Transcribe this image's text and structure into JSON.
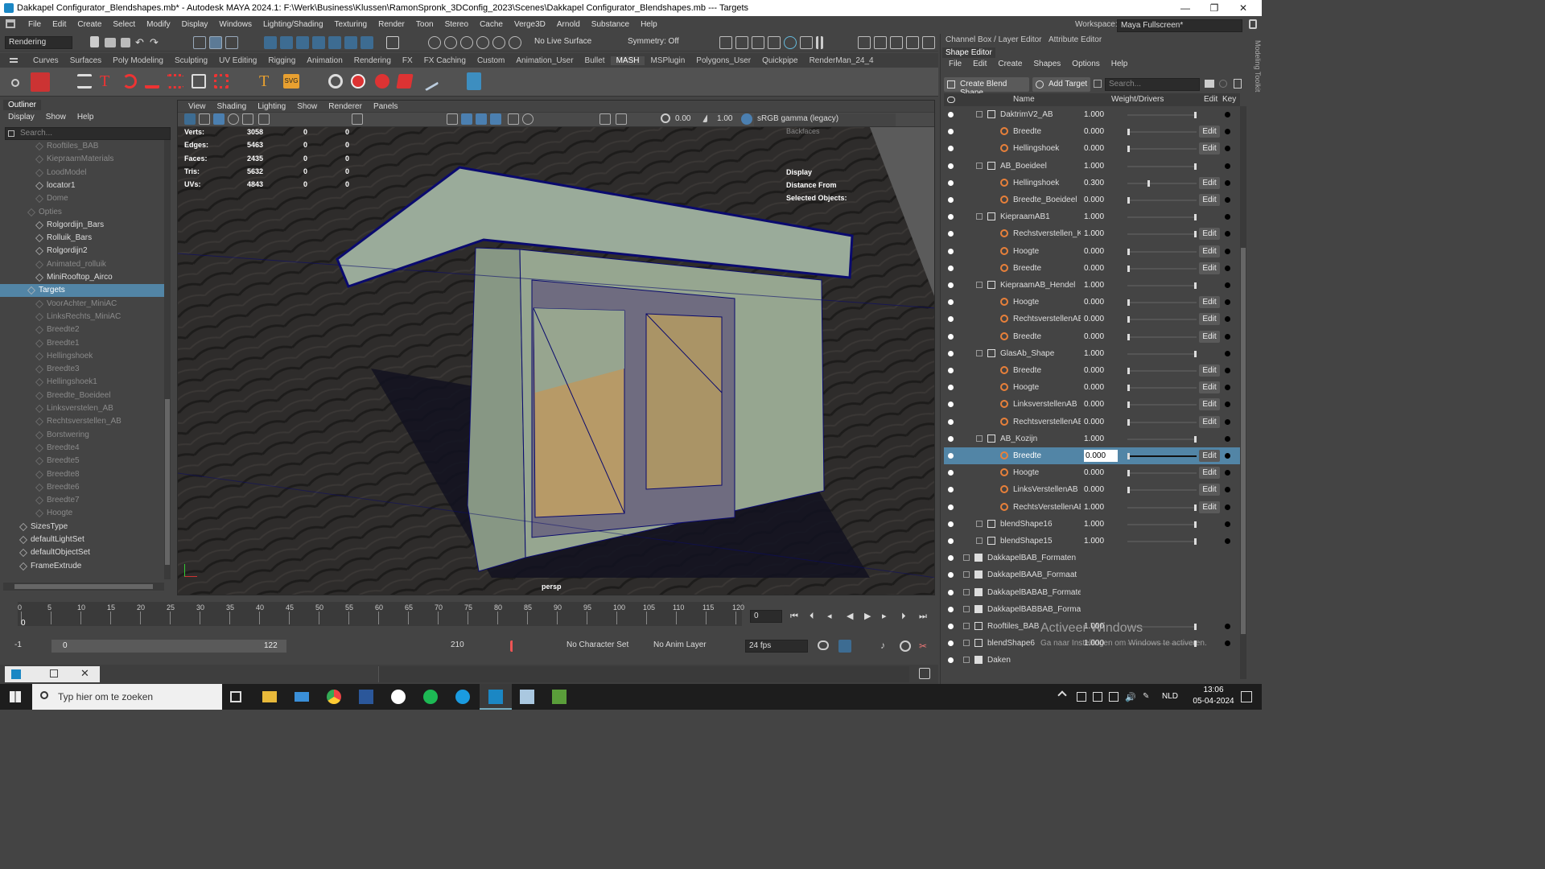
{
  "titlebar": {
    "title": "Dakkapel Configurator_Blendshapes.mb* - Autodesk MAYA 2024.1: F:\\Werk\\Business\\Klussen\\RamonSpronk_3DConfig_2023\\Scenes\\Dakkapel Configurator_Blendshapes.mb    ---    Targets",
    "minimize": "—",
    "maximize": "❐",
    "close": "✕"
  },
  "menubar": {
    "items": [
      "File",
      "Edit",
      "Create",
      "Select",
      "Modify",
      "Display",
      "Windows",
      "Lighting/Shading",
      "Texturing",
      "Render",
      "Toon",
      "Stereo",
      "Cache",
      "Verge3D",
      "Arnold",
      "Substance",
      "Help"
    ]
  },
  "statusline": {
    "menuset": "Rendering",
    "live_surface": "No Live Surface",
    "symmetry": "Symmetry: Off"
  },
  "workspace": {
    "label": "Workspace:",
    "value": "Maya Fullscreen*"
  },
  "shelf": {
    "tabs": [
      "Curves",
      "Surfaces",
      "Poly Modeling",
      "Sculpting",
      "UV Editing",
      "Rigging",
      "Animation",
      "Rendering",
      "FX",
      "FX Caching",
      "Custom",
      "Animation_User",
      "Bullet",
      "MASH",
      "MSPlugin",
      "Polygons_User",
      "Quickpipe",
      "RenderMan_24_4"
    ],
    "active_tab": "MASH"
  },
  "outliner": {
    "title": "Outliner",
    "menu": [
      "Display",
      "Show",
      "Help"
    ],
    "search_placeholder": "Search...",
    "rows": [
      {
        "label": "Rooftiles_BAB",
        "dim": true
      },
      {
        "label": "KiepraamMaterials",
        "dim": true
      },
      {
        "label": "LoodModel",
        "dim": true
      },
      {
        "label": "locator1",
        "dim": false
      },
      {
        "label": "Dome",
        "dim": true
      },
      {
        "label": "Opties",
        "dim": true
      },
      {
        "label": "Rolgordijn_Bars",
        "dim": false
      },
      {
        "label": "Rolluik_Bars",
        "dim": false
      },
      {
        "label": "Rolgordijn2",
        "dim": false
      },
      {
        "label": "Animated_rolluik",
        "dim": true
      },
      {
        "label": "MiniRooftop_Airco",
        "dim": false
      },
      {
        "label": "Targets",
        "dim": false,
        "selected": true
      },
      {
        "label": "VoorAchter_MiniAC",
        "dim": true
      },
      {
        "label": "LinksRechts_MiniAC",
        "dim": true
      },
      {
        "label": "Breedte2",
        "dim": true
      },
      {
        "label": "Breedte1",
        "dim": true
      },
      {
        "label": "Hellingshoek",
        "dim": true
      },
      {
        "label": "Breedte3",
        "dim": true
      },
      {
        "label": "Hellingshoek1",
        "dim": true
      },
      {
        "label": "Breedte_Boeideel",
        "dim": true
      },
      {
        "label": "Linksverstelen_AB",
        "dim": true
      },
      {
        "label": "Rechtsverstellen_AB",
        "dim": true
      },
      {
        "label": "Borstwering",
        "dim": true
      },
      {
        "label": "Breedte4",
        "dim": true
      },
      {
        "label": "Breedte5",
        "dim": true
      },
      {
        "label": "Breedte8",
        "dim": true
      },
      {
        "label": "Breedte6",
        "dim": true
      },
      {
        "label": "Breedte7",
        "dim": true
      },
      {
        "label": "Hoogte",
        "dim": true
      },
      {
        "label": "SizesType",
        "dim": false
      },
      {
        "label": "defaultLightSet",
        "dim": false
      },
      {
        "label": "defaultObjectSet",
        "dim": false
      },
      {
        "label": "FrameExtrude",
        "dim": false
      }
    ]
  },
  "viewport": {
    "menu": [
      "View",
      "Shading",
      "Lighting",
      "Show",
      "Renderer",
      "Panels"
    ],
    "exposure": "0.00",
    "gamma": "1.00",
    "colorspace": "sRGB gamma (legacy)",
    "camera": "persp",
    "hud": [
      {
        "label": "Verts:",
        "a": "3058",
        "b": "0",
        "c": "0"
      },
      {
        "label": "Edges:",
        "a": "5463",
        "b": "0",
        "c": "0"
      },
      {
        "label": "Faces:",
        "a": "2435",
        "b": "0",
        "c": "0"
      },
      {
        "label": "Tris:",
        "a": "5632",
        "b": "0",
        "c": "0"
      },
      {
        "label": "UVs:",
        "a": "4843",
        "b": "0",
        "c": "0"
      }
    ],
    "hud_right": [
      "Display",
      "Distance From",
      "Selected Objects:"
    ],
    "backfaces": "Backfaces"
  },
  "timeline": {
    "ticks": [
      "0",
      "5",
      "10",
      "15",
      "20",
      "25",
      "30",
      "35",
      "40",
      "45",
      "50",
      "55",
      "60",
      "65",
      "70",
      "75",
      "80",
      "85",
      "90",
      "95",
      "100",
      "105",
      "110",
      "115",
      "120"
    ],
    "current_frame": "0",
    "current_field": "0"
  },
  "range": {
    "start": "-1",
    "inner_start": "0",
    "inner_end": "122",
    "end": "210",
    "character_set": "No Character Set",
    "anim_layer": "No Anim Layer",
    "fps": "24 fps"
  },
  "channel_tabs": [
    "Channel Box / Layer Editor",
    "Attribute Editor"
  ],
  "shape_editor": {
    "title": "Shape Editor",
    "menu": [
      "File",
      "Edit",
      "Create",
      "Shapes",
      "Options",
      "Help"
    ],
    "create_blend": "Create Blend Shape",
    "add_target": "Add Target",
    "search_placeholder": "Search...",
    "columns": {
      "name": "Name",
      "weight": "Weight/Drivers",
      "edit": "Edit",
      "key": "Key"
    },
    "edit_label": "Edit",
    "rows": [
      {
        "name": "DaktrimV2_AB",
        "weight": "1.000",
        "level": 1,
        "type": "blend",
        "pos": 1.0
      },
      {
        "name": "Breedte",
        "weight": "0.000",
        "level": 2,
        "type": "target",
        "pos": 0.0
      },
      {
        "name": "Hellingshoek",
        "weight": "0.000",
        "level": 2,
        "type": "target",
        "pos": 0.0
      },
      {
        "name": "AB_Boeideel",
        "weight": "1.000",
        "level": 1,
        "type": "blend",
        "pos": 1.0
      },
      {
        "name": "Hellingshoek",
        "weight": "0.300",
        "level": 2,
        "type": "target",
        "pos": 0.3
      },
      {
        "name": "Breedte_Boeideel",
        "weight": "0.000",
        "level": 2,
        "type": "target",
        "pos": 0.0
      },
      {
        "name": "KiepraamAB1",
        "weight": "1.000",
        "level": 1,
        "type": "blend",
        "pos": 1.0
      },
      {
        "name": "Rechstverstellen_Kie",
        "weight": "1.000",
        "level": 2,
        "type": "target",
        "pos": 1.0
      },
      {
        "name": "Hoogte",
        "weight": "0.000",
        "level": 2,
        "type": "target",
        "pos": 0.0
      },
      {
        "name": "Breedte",
        "weight": "0.000",
        "level": 2,
        "type": "target",
        "pos": 0.0
      },
      {
        "name": "KiepraamAB_Hendel",
        "weight": "1.000",
        "level": 1,
        "type": "blend",
        "pos": 1.0
      },
      {
        "name": "Hoogte",
        "weight": "0.000",
        "level": 2,
        "type": "target",
        "pos": 0.0
      },
      {
        "name": "RechtsverstellenAB_H",
        "weight": "0.000",
        "level": 2,
        "type": "target",
        "pos": 0.0
      },
      {
        "name": "Breedte",
        "weight": "0.000",
        "level": 2,
        "type": "target",
        "pos": 0.0
      },
      {
        "name": "GlasAb_Shape",
        "weight": "1.000",
        "level": 1,
        "type": "blend",
        "pos": 1.0
      },
      {
        "name": "Breedte",
        "weight": "0.000",
        "level": 2,
        "type": "target",
        "pos": 0.0
      },
      {
        "name": "Hoogte",
        "weight": "0.000",
        "level": 2,
        "type": "target",
        "pos": 0.0
      },
      {
        "name": "LinksverstellenAB",
        "weight": "0.000",
        "level": 2,
        "type": "target",
        "pos": 0.0
      },
      {
        "name": "RechtsverstellenAB",
        "weight": "0.000",
        "level": 2,
        "type": "target",
        "pos": 0.0
      },
      {
        "name": "AB_Kozijn",
        "weight": "1.000",
        "level": 1,
        "type": "blend",
        "pos": 1.0
      },
      {
        "name": "Breedte",
        "weight": "0.000",
        "level": 2,
        "type": "target",
        "pos": 0.0,
        "selected": true
      },
      {
        "name": "Hoogte",
        "weight": "0.000",
        "level": 2,
        "type": "target",
        "pos": 0.0
      },
      {
        "name": "LinksVerstellenAB",
        "weight": "0.000",
        "level": 2,
        "type": "target",
        "pos": 0.0
      },
      {
        "name": "RechtsVerstellenAB",
        "weight": "1.000",
        "level": 2,
        "type": "target",
        "pos": 1.0
      },
      {
        "name": "blendShape16",
        "weight": "1.000",
        "level": 1,
        "type": "blend",
        "pos": 1.0,
        "collapsed": true
      },
      {
        "name": "blendShape15",
        "weight": "1.000",
        "level": 1,
        "type": "blend",
        "pos": 1.0,
        "collapsed": true
      },
      {
        "name": "DakkapelBAB_Formaten",
        "weight": "",
        "level": 0,
        "type": "folder"
      },
      {
        "name": "DakkapelBAAB_Formaat",
        "weight": "",
        "level": 0,
        "type": "folder"
      },
      {
        "name": "DakkapelBABAB_Formaten",
        "weight": "",
        "level": 0,
        "type": "folder"
      },
      {
        "name": "DakkapelBABBAB_Formaten",
        "weight": "",
        "level": 0,
        "type": "folder"
      },
      {
        "name": "Rooftiles_BAB",
        "weight": "1.000",
        "level": 0,
        "type": "blend",
        "pos": 1.0,
        "collapsed": true
      },
      {
        "name": "blendShape6",
        "weight": "1.000",
        "level": 0,
        "type": "blend",
        "pos": 1.0
      },
      {
        "name": "Daken",
        "weight": "",
        "level": 0,
        "type": "folder"
      }
    ]
  },
  "activation": {
    "title": "Activeer Windows",
    "subtitle": "Ga naar Instellingen om Windows te activeren."
  },
  "side_label": "Modeling Toolkit",
  "taskbar": {
    "search_placeholder": "Typ hier om te zoeken",
    "lang": "NLD",
    "time": "13:06",
    "date": "05-04-2024"
  },
  "colors": {
    "selection": "#5285a6",
    "panel": "#444444",
    "viewport_bg": "#3a3a3a",
    "wire": "#0a0a6e",
    "body": "#8fa08f"
  }
}
